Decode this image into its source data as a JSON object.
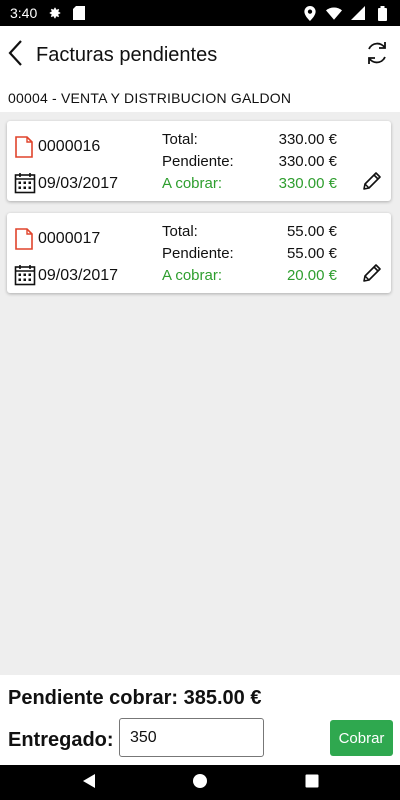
{
  "status_bar": {
    "time": "3:40",
    "left_icons": [
      "gear-icon",
      "sd-card-icon"
    ],
    "right_icons": [
      "location-icon",
      "wifi-icon",
      "signal-icon",
      "battery-icon"
    ]
  },
  "app_bar": {
    "title": "Facturas pendientes",
    "back_icon": "chevron-left-icon",
    "sync_icon": "sync-icon"
  },
  "client": {
    "label": "00004 - VENTA Y DISTRIBUCION GALDON"
  },
  "invoices": [
    {
      "number": "0000016",
      "date": "09/03/2017",
      "total_label": "Total:",
      "total": "330.00 €",
      "pending_label": "Pendiente:",
      "pending": "330.00 €",
      "to_charge_label": "A cobrar:",
      "to_charge": "330.00 €"
    },
    {
      "number": "0000017",
      "date": "09/03/2017",
      "total_label": "Total:",
      "total": "55.00 €",
      "pending_label": "Pendiente:",
      "pending": "55.00 €",
      "to_charge_label": "A cobrar:",
      "to_charge": "20.00 €"
    }
  ],
  "footer": {
    "pending_total": "Pendiente cobrar: 385.00 €",
    "delivered_label": "Entregado:",
    "delivered_value": "350",
    "charge_button": "Cobrar"
  },
  "colors": {
    "accent_green": "#2e9e2e",
    "button_green": "#2fa84f",
    "doc_icon_red": "#e0442c"
  }
}
